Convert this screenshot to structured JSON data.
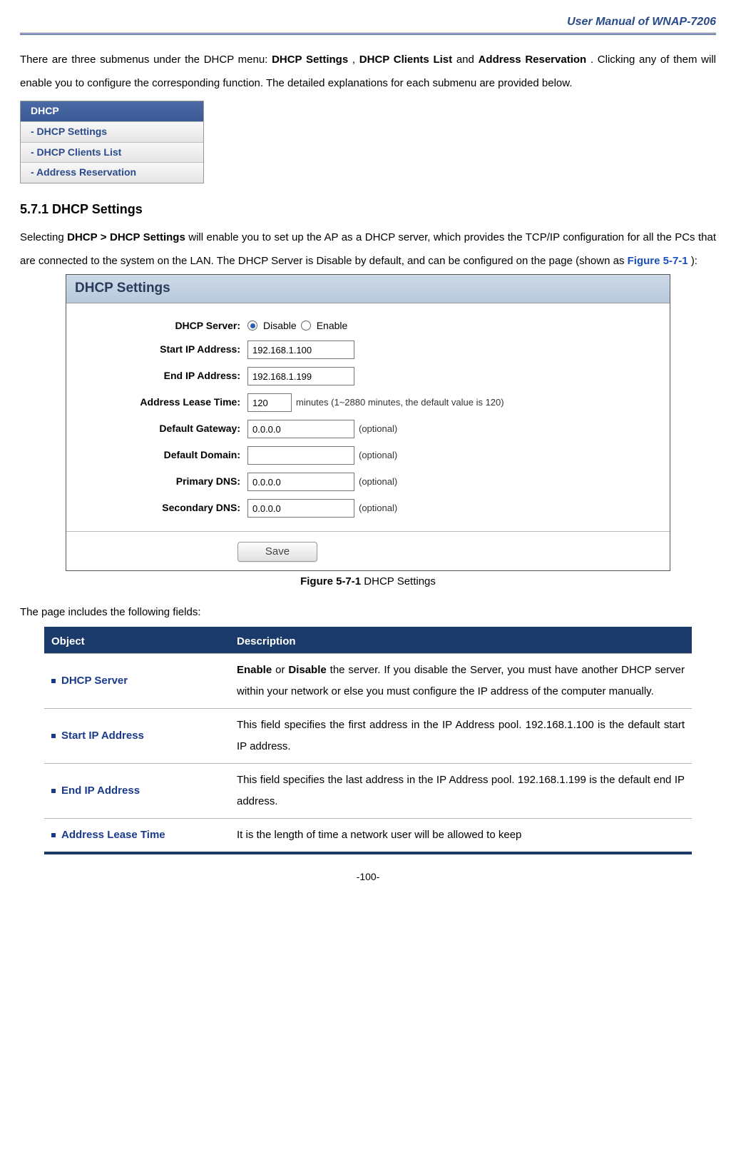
{
  "header": {
    "product": "User Manual of WNAP-7206"
  },
  "intro": {
    "prefix": "There are three submenus under the DHCP menu: ",
    "m1": "DHCP Settings",
    "sep1": ", ",
    "m2": "DHCP Clients List",
    "sep2": " and ",
    "m3": "Address Reservation",
    "suffix": ". Clicking any of them will enable you to configure the corresponding function. The detailed explanations for each submenu are provided below."
  },
  "menu": {
    "header": "DHCP",
    "items": [
      "- DHCP Settings",
      "- DHCP Clients List",
      "- Address Reservation"
    ]
  },
  "section": {
    "heading": "5.7.1   DHCP Settings",
    "p1a": "Selecting ",
    "p1b": "DHCP > DHCP Settings",
    "p1c": " will enable you to set up the AP as a DHCP server, which provides the TCP/IP configuration for all the PCs that are connected to the system on the LAN. The DHCP Server is Disable by default, and can be configured on the page (shown as ",
    "p1link": "Figure 5-7-1",
    "p1d": "):"
  },
  "panel": {
    "title": "DHCP Settings",
    "labels": {
      "server": "DHCP Server:",
      "start": "Start IP Address:",
      "end": "End IP Address:",
      "lease": "Address Lease Time:",
      "gateway": "Default Gateway:",
      "domain": "Default Domain:",
      "pdns": "Primary DNS:",
      "sdns": "Secondary DNS:"
    },
    "radios": {
      "disable": "Disable",
      "enable": "Enable"
    },
    "values": {
      "start": "192.168.1.100",
      "end": "192.168.1.199",
      "lease": "120",
      "gateway": "0.0.0.0",
      "domain": "",
      "pdns": "0.0.0.0",
      "sdns": "0.0.0.0"
    },
    "lease_hint": "minutes (1~2880 minutes, the default value is 120)",
    "optional": "(optional)",
    "save": "Save"
  },
  "caption": {
    "bold": "Figure 5-7-1",
    "rest": " DHCP Settings"
  },
  "includes": "The page includes the following fields:",
  "table": {
    "headers": {
      "object": "Object",
      "desc": "Description"
    },
    "rows": [
      {
        "obj": "DHCP Server",
        "desc": {
          "b1": "Enable",
          "t1": " or ",
          "b2": "Disable",
          "t2": " the server. If you disable the Server, you must have another DHCP server within your network or else you must configure the IP address of the computer manually."
        }
      },
      {
        "obj": "Start IP Address",
        "desc_plain": "This field specifies the first address in the IP Address pool. 192.168.1.100 is the default start IP address."
      },
      {
        "obj": "End IP Address",
        "desc_plain": "This field specifies the last address in the IP Address pool. 192.168.1.199 is the default end IP address."
      },
      {
        "obj": "Address Lease Time",
        "desc_plain": "It is the length of time a network user will be allowed to keep"
      }
    ]
  },
  "page_number": "-100-"
}
